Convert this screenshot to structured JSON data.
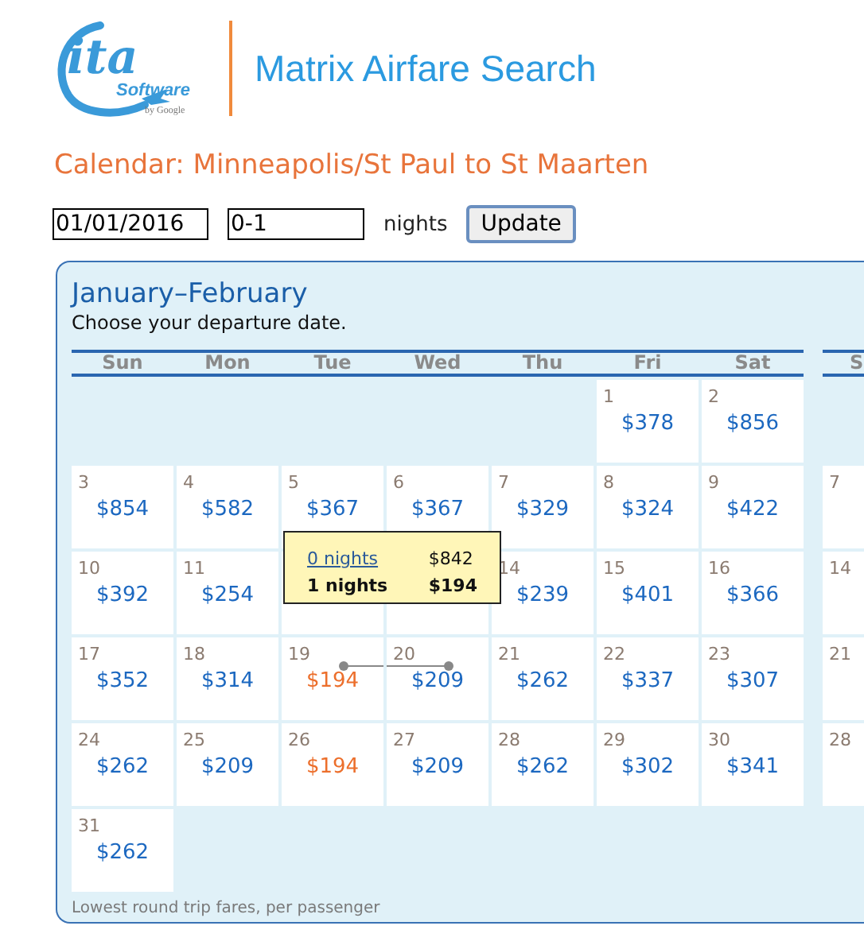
{
  "logo": {
    "mark": "ita",
    "software": "Software",
    "by": "by Google"
  },
  "title": "Matrix Airfare Search",
  "heading": "Calendar: Minneapolis/St Paul to St Maarten",
  "search": {
    "date": "01/01/2016",
    "nights": "0-1",
    "nights_label": "nights",
    "button": "Update"
  },
  "calendar": {
    "title": "January–February",
    "subtitle": "Choose your departure date.",
    "footer": "Lowest round trip fares, per passenger",
    "weekdays": [
      "Sun",
      "Mon",
      "Tue",
      "Wed",
      "Thu",
      "Fri",
      "Sat"
    ],
    "weeks": [
      [
        {
          "kind": "empty"
        },
        {
          "kind": "empty"
        },
        {
          "kind": "empty"
        },
        {
          "kind": "empty"
        },
        {
          "kind": "empty"
        },
        {
          "kind": "fare",
          "day": "1",
          "price": "$378",
          "cheapest": false
        },
        {
          "kind": "fare",
          "day": "2",
          "price": "$856",
          "cheapest": false
        }
      ],
      [
        {
          "kind": "fare",
          "day": "3",
          "price": "$854",
          "cheapest": false
        },
        {
          "kind": "fare",
          "day": "4",
          "price": "$582",
          "cheapest": false
        },
        {
          "kind": "fare",
          "day": "5",
          "price": "$367",
          "cheapest": false
        },
        {
          "kind": "fare",
          "day": "6",
          "price": "$367",
          "cheapest": false
        },
        {
          "kind": "fare",
          "day": "7",
          "price": "$329",
          "cheapest": false
        },
        {
          "kind": "fare",
          "day": "8",
          "price": "$324",
          "cheapest": false
        },
        {
          "kind": "fare",
          "day": "9",
          "price": "$422",
          "cheapest": false
        }
      ],
      [
        {
          "kind": "fare",
          "day": "10",
          "price": "$392",
          "cheapest": false
        },
        {
          "kind": "fare",
          "day": "11",
          "price": "$254",
          "cheapest": false
        },
        {
          "kind": "covered"
        },
        {
          "kind": "covered"
        },
        {
          "kind": "fare",
          "day": "14",
          "price": "$239",
          "cheapest": false
        },
        {
          "kind": "fare",
          "day": "15",
          "price": "$401",
          "cheapest": false
        },
        {
          "kind": "fare",
          "day": "16",
          "price": "$366",
          "cheapest": false
        }
      ],
      [
        {
          "kind": "fare",
          "day": "17",
          "price": "$352",
          "cheapest": false
        },
        {
          "kind": "fare",
          "day": "18",
          "price": "$314",
          "cheapest": false
        },
        {
          "kind": "fare",
          "day": "19",
          "price": "$194",
          "cheapest": true,
          "trip_start": true
        },
        {
          "kind": "fare",
          "day": "20",
          "price": "$209",
          "cheapest": false,
          "trip_end": true
        },
        {
          "kind": "fare",
          "day": "21",
          "price": "$262",
          "cheapest": false
        },
        {
          "kind": "fare",
          "day": "22",
          "price": "$337",
          "cheapest": false
        },
        {
          "kind": "fare",
          "day": "23",
          "price": "$307",
          "cheapest": false
        }
      ],
      [
        {
          "kind": "fare",
          "day": "24",
          "price": "$262",
          "cheapest": false
        },
        {
          "kind": "fare",
          "day": "25",
          "price": "$209",
          "cheapest": false
        },
        {
          "kind": "fare",
          "day": "26",
          "price": "$194",
          "cheapest": true
        },
        {
          "kind": "fare",
          "day": "27",
          "price": "$209",
          "cheapest": false
        },
        {
          "kind": "fare",
          "day": "28",
          "price": "$262",
          "cheapest": false
        },
        {
          "kind": "fare",
          "day": "29",
          "price": "$302",
          "cheapest": false
        },
        {
          "kind": "fare",
          "day": "30",
          "price": "$341",
          "cheapest": false
        }
      ],
      [
        {
          "kind": "fare",
          "day": "31",
          "price": "$262",
          "cheapest": false
        },
        {
          "kind": "empty"
        },
        {
          "kind": "empty"
        },
        {
          "kind": "empty"
        },
        {
          "kind": "empty"
        },
        {
          "kind": "empty"
        },
        {
          "kind": "empty"
        }
      ]
    ],
    "tooltip": [
      {
        "label": "0 nights",
        "price": "$842",
        "selected": false
      },
      {
        "label": "1 nights",
        "price": "$194",
        "selected": true
      }
    ],
    "next_month": {
      "weekday": "S",
      "days": [
        {
          "kind": "empty"
        },
        {
          "kind": "day",
          "day": "7"
        },
        {
          "kind": "day",
          "day": "14"
        },
        {
          "kind": "day",
          "day": "21"
        },
        {
          "kind": "day",
          "day": "28"
        }
      ]
    }
  }
}
